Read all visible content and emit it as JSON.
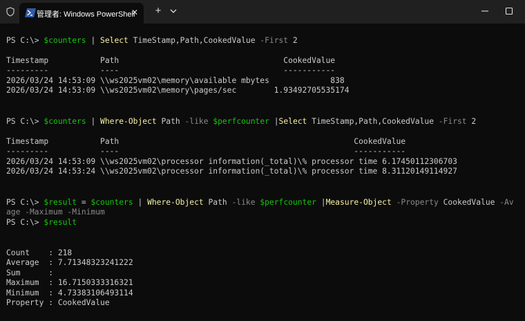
{
  "tab": {
    "title": "管理者: Windows PowerShell",
    "close": "✕"
  },
  "newtab": {
    "label": "+"
  },
  "icons": [
    "shield-icon",
    "powershell-icon",
    "close-icon",
    "plus-icon",
    "chevron-down-icon",
    "minimize-icon",
    "maximize-icon"
  ],
  "colors": {
    "background": "#0c0c0c",
    "titlebar": "#202020",
    "variable": "#16c60c",
    "command": "#f9f1a5",
    "parameter": "#8a8a8a",
    "text": "#cccccc"
  },
  "cmd1": {
    "prompt": "PS C:\\> ",
    "var": "$counters",
    "pipe": " | ",
    "cmd": "Select",
    "args": " TimeStamp,Path,CookedValue ",
    "param": "-First",
    "num": " 2"
  },
  "table1": {
    "header": "Timestamp           Path                                   CookedValue",
    "underline": "---------           ----                                   -----------",
    "rows": [
      "2026/03/24 14:53:09 \\\\ws2025vm02\\memory\\available mbytes             838",
      "2026/03/24 14:53:09 \\\\ws2025vm02\\memory\\pages/sec        1.93492705535174"
    ]
  },
  "cmd2": {
    "prompt": "PS C:\\> ",
    "var": "$counters",
    "pipe": " | ",
    "cmd": "Where-Object",
    "path": " Path ",
    "param": "-like",
    "sp": " ",
    "var2": "$perfcounter",
    "pipe2": " |",
    "cmd2": "Select",
    "args": " TimeStamp,Path,CookedValue ",
    "param2": "-First",
    "num": " 2"
  },
  "table2": {
    "header": "Timestamp           Path                                                  CookedValue",
    "underline": "---------           ----                                                  -----------",
    "rows": [
      "2026/03/24 14:53:09 \\\\ws2025vm02\\processor information(_total)\\% processor time 6.17450112306703",
      "2026/03/24 14:53:24 \\\\ws2025vm02\\processor information(_total)\\% processor time 8.31120149114927"
    ]
  },
  "cmd3": {
    "prompt": "PS C:\\> ",
    "var": "$result",
    "eq": " = ",
    "var2": "$counters",
    "pipe": " | ",
    "cmd": "Where-Object",
    "path": " Path ",
    "param": "-like",
    "sp": " ",
    "var3": "$perfcounter",
    "pipe2": " |",
    "cmd2": "Measure-Object",
    "sp2": " ",
    "param2": "-Property",
    "val": " CookedValue ",
    "param3": "-Av",
    "wrap": "age -Maximum -Minimum"
  },
  "cmd4": {
    "prompt": "PS C:\\> ",
    "var": "$result"
  },
  "result": [
    "Count    : 218",
    "Average  : 7.71348323241222",
    "Sum      :",
    "Maximum  : 16.7150333316321",
    "Minimum  : 4.73383106493114",
    "Property : CookedValue"
  ]
}
